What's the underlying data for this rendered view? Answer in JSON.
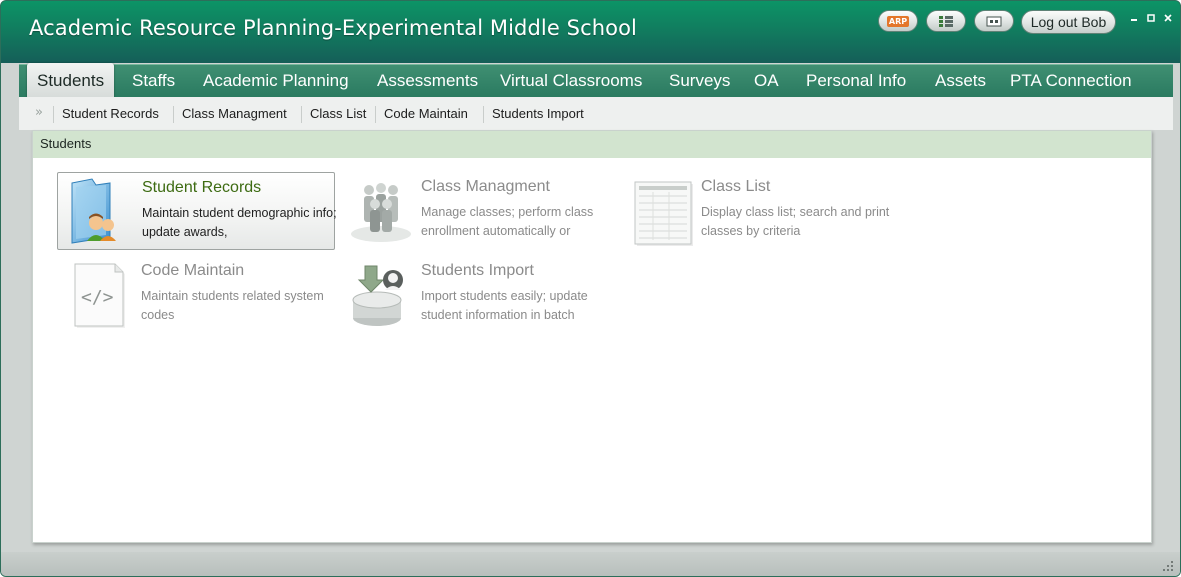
{
  "window": {
    "title": "Academic Resource Planning-Experimental Middle School",
    "logout_label": "Log out Bob",
    "arp_label": "ARP"
  },
  "menu": [
    {
      "label": "Students",
      "active": true
    },
    {
      "label": "Staffs"
    },
    {
      "label": "Academic Planning"
    },
    {
      "label": "Assessments"
    },
    {
      "label": "Virtual Classrooms"
    },
    {
      "label": "Surveys"
    },
    {
      "label": "OA"
    },
    {
      "label": "Personal Info"
    },
    {
      "label": "Assets"
    },
    {
      "label": "PTA Connection"
    }
  ],
  "submenu": {
    "arrow": "»",
    "items": [
      "Student Records",
      "Class Managment",
      "Class List",
      "Code Maintain",
      "Students Import"
    ]
  },
  "panel": {
    "title": "Students",
    "cards": [
      {
        "title": "Student Records",
        "desc": "Maintain student demographic info; update awards,",
        "icon": "student-records-icon",
        "selected": true
      },
      {
        "title": "Class Managment",
        "desc": "Manage classes; perform class enrollment automatically or",
        "icon": "class-management-icon"
      },
      {
        "title": "Class List",
        "desc": "Display class list; search and print classes by criteria",
        "icon": "class-list-icon"
      },
      {
        "title": "Code Maintain",
        "desc": "Maintain students related system codes",
        "icon": "code-maintain-icon"
      },
      {
        "title": "Students Import",
        "desc": "Import students easily; update student information in batch",
        "icon": "students-import-icon"
      }
    ]
  },
  "colors": {
    "titlebar": "#117d5f",
    "menubar": "#2a7a60",
    "panel_header": "#d2e4cf",
    "selected_title": "#3d6b12"
  }
}
